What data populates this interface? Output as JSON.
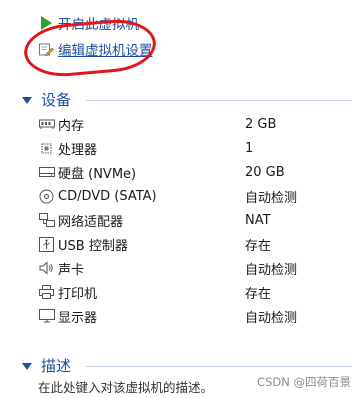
{
  "actions": {
    "power_on": "开启此虚拟机",
    "edit_settings": "编辑虚拟机设置"
  },
  "devices_section": {
    "title": "设备"
  },
  "devices": [
    {
      "icon": "memory-icon",
      "name": "内存",
      "value": "2 GB"
    },
    {
      "icon": "processor-icon",
      "name": "处理器",
      "value": "1"
    },
    {
      "icon": "hard-disk-icon",
      "name": "硬盘 (NVMe)",
      "value": "20 GB"
    },
    {
      "icon": "cd-dvd-icon",
      "name": "CD/DVD (SATA)",
      "value": "自动检测"
    },
    {
      "icon": "network-adapter-icon",
      "name": "网络适配器",
      "value": "NAT"
    },
    {
      "icon": "usb-icon",
      "name": "USB 控制器",
      "value": "存在"
    },
    {
      "icon": "sound-card-icon",
      "name": "声卡",
      "value": "自动检测"
    },
    {
      "icon": "printer-icon",
      "name": "打印机",
      "value": "存在"
    },
    {
      "icon": "display-icon",
      "name": "显示器",
      "value": "自动检测"
    }
  ],
  "description_section": {
    "title": "描述",
    "placeholder": "在此处键入对该虚拟机的描述。"
  },
  "watermark": "CSDN @四荷百景",
  "colors": {
    "link": "#1f4fa0",
    "annotation": "#e2161b",
    "play": "#2aa52a"
  }
}
